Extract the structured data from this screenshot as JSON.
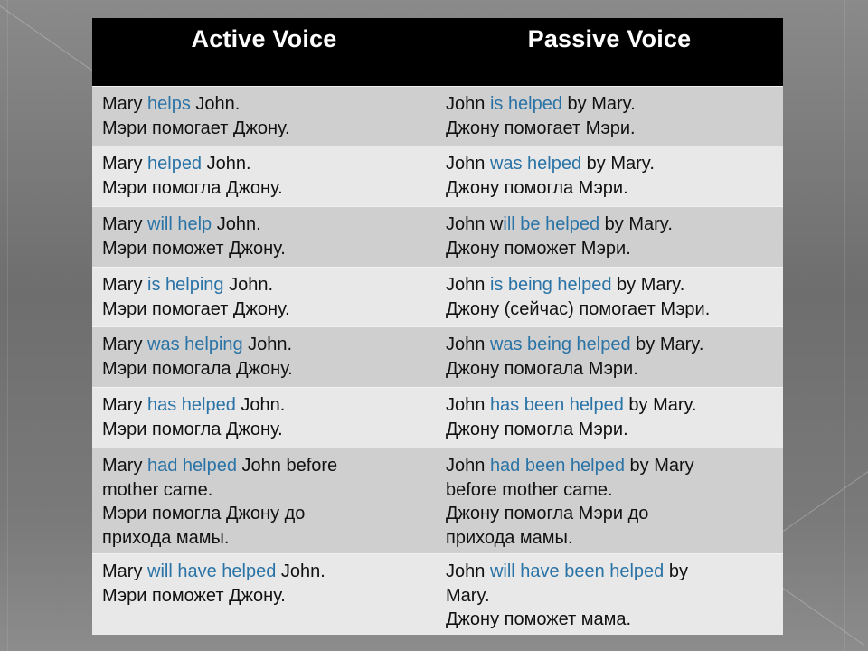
{
  "header": {
    "active": "Active Voice",
    "passive": "Passive Voice"
  },
  "colors": {
    "header_bg": "#000000",
    "header_text": "#ffffff",
    "row_dark": "#cfcfcf",
    "row_light": "#e8e8e8",
    "highlight": "#2a73a6",
    "text": "#111111",
    "background": "#7a7a7a"
  },
  "rows": [
    {
      "active": {
        "lines": [
          {
            "pre": "Mary ",
            "hl": "helps",
            "post": " John."
          },
          {
            "pre": "Мэри помогает Джону.",
            "hl": "",
            "post": ""
          }
        ]
      },
      "passive": {
        "lines": [
          {
            "pre": "John ",
            "hl": "is helped",
            "post": " by Mary."
          },
          {
            "pre": "Джону помогает Мэри.",
            "hl": "",
            "post": ""
          }
        ]
      }
    },
    {
      "active": {
        "lines": [
          {
            "pre": "Mary ",
            "hl": "helped",
            "post": " John."
          },
          {
            "pre": "Мэри помогла Джону.",
            "hl": "",
            "post": ""
          }
        ]
      },
      "passive": {
        "lines": [
          {
            "pre": "John ",
            "hl": "was helped",
            "post": " by Mary."
          },
          {
            "pre": "Джону помогла Мэри.",
            "hl": "",
            "post": ""
          }
        ]
      }
    },
    {
      "active": {
        "lines": [
          {
            "pre": "Mary ",
            "hl": "will help",
            "post": " John."
          },
          {
            "pre": "Мэри поможет Джону.",
            "hl": "",
            "post": ""
          }
        ]
      },
      "passive": {
        "lines": [
          {
            "pre": "John w",
            "hl": "ill be helped",
            "post": " by Mary."
          },
          {
            "pre": "Джону поможет Мэри.",
            "hl": "",
            "post": ""
          }
        ]
      }
    },
    {
      "active": {
        "lines": [
          {
            "pre": "Mary ",
            "hl": "is helping",
            "post": " John."
          },
          {
            "pre": "Мэри помогает Джону.",
            "hl": "",
            "post": ""
          }
        ]
      },
      "passive": {
        "lines": [
          {
            "pre": "John ",
            "hl": "is being helped",
            "post": " by Mary."
          },
          {
            "pre": "Джону (сейчас) помогает Мэри.",
            "hl": "",
            "post": ""
          }
        ]
      }
    },
    {
      "active": {
        "lines": [
          {
            "pre": "Mary ",
            "hl": "was helping",
            "post": " John."
          },
          {
            "pre": "Мэри помогала Джону.",
            "hl": "",
            "post": ""
          }
        ]
      },
      "passive": {
        "lines": [
          {
            "pre": "John ",
            "hl": "was being helped",
            "post": " by Mary."
          },
          {
            "pre": "Джону помогала Мэри.",
            "hl": "",
            "post": ""
          }
        ]
      }
    },
    {
      "active": {
        "lines": [
          {
            "pre": "Mary ",
            "hl": "has helped",
            "post": " John."
          },
          {
            "pre": "Мэри помогла Джону.",
            "hl": "",
            "post": ""
          }
        ]
      },
      "passive": {
        "lines": [
          {
            "pre": "John ",
            "hl": "has been helped",
            "post": " by Mary."
          },
          {
            "pre": "Джону помогла Мэри.",
            "hl": "",
            "post": ""
          }
        ]
      }
    },
    {
      "active": {
        "lines": [
          {
            "pre": "Mary ",
            "hl": "had helped",
            "post": " John before"
          },
          {
            "pre": "mother came.",
            "hl": "",
            "post": ""
          },
          {
            "pre": "Мэри помогла Джону до",
            "hl": "",
            "post": ""
          },
          {
            "pre": "прихода мамы.",
            "hl": "",
            "post": ""
          }
        ]
      },
      "passive": {
        "lines": [
          {
            "pre": "John ",
            "hl": "had been helped",
            "post": " by Mary"
          },
          {
            "pre": "before mother came.",
            "hl": "",
            "post": ""
          },
          {
            "pre": "Джону помогла Мэри до",
            "hl": "",
            "post": ""
          },
          {
            "pre": "прихода мамы.",
            "hl": "",
            "post": ""
          }
        ]
      }
    },
    {
      "active": {
        "lines": [
          {
            "pre": "Mary ",
            "hl": "will have helped",
            "post": " John."
          },
          {
            "pre": "Мэри поможет Джону.",
            "hl": "",
            "post": ""
          }
        ]
      },
      "passive": {
        "lines": [
          {
            "pre": "John ",
            "hl": "will have been helped",
            "post": " by"
          },
          {
            "pre": "Mary.",
            "hl": "",
            "post": ""
          },
          {
            "pre": "Джону поможет мама.",
            "hl": "",
            "post": ""
          }
        ]
      }
    }
  ]
}
